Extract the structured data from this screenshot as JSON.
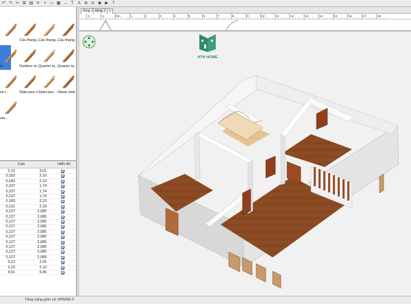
{
  "toolbar": {
    "buttons": [
      "undo-icon",
      "redo-icon",
      "cut-icon",
      "copy-icon",
      "paste-icon",
      "delete-icon",
      "add-furniture-icon",
      "create-walls-icon",
      "create-rooms-icon",
      "create-dimensions-icon",
      "create-labels-icon",
      "text-style-icon",
      "zoom-in-icon",
      "zoom-out-icon",
      "create-photo-icon",
      "create-video-icon",
      "help-icon"
    ]
  },
  "catalog": {
    "items": [
      {
        "label": "",
        "icon": "staircase-icon"
      },
      {
        "label": "Cầu thang...",
        "icon": "staircase-icon"
      },
      {
        "label": "Cầu thang...",
        "icon": "staircase-icon"
      },
      {
        "label": "Cầu thang...",
        "icon": "staircase-icon"
      },
      {
        "label": "d...",
        "icon": "staircase-icon"
      },
      {
        "label": "Outdoor st...",
        "icon": "staircase-icon"
      },
      {
        "label": "Quarter la...",
        "icon": "staircase-icon"
      },
      {
        "label": "Quarter la...",
        "icon": "staircase-icon"
      },
      {
        "label": "se l...",
        "icon": "staircase-icon"
      },
      {
        "label": "Staircase v...",
        "icon": "staircase-icon"
      },
      {
        "label": "Staircase ...",
        "icon": "staircase-icon"
      },
      {
        "label": "Steep stair...",
        "icon": "staircase-icon"
      },
      {
        "label": "sta...",
        "icon": "staircase-icon"
      }
    ]
  },
  "furniture": {
    "headers": {
      "height": "Cao",
      "visible": "Hiển thị"
    },
    "rows": [
      [
        "0,10",
        "3,01"
      ],
      [
        "0,183",
        "2,10"
      ],
      [
        "0,183",
        "2,10"
      ],
      [
        "0,237",
        "1,74"
      ],
      [
        "0,237",
        "1,74"
      ],
      [
        "0,237",
        "1,74"
      ],
      [
        "0,183",
        "2,10"
      ],
      [
        "0,131",
        "2,18"
      ],
      [
        "0,127",
        "2,085"
      ],
      [
        "0,127",
        "2,085"
      ],
      [
        "0,127",
        "2,085"
      ],
      [
        "0,127",
        "2,085"
      ],
      [
        "0,127",
        "2,085"
      ],
      [
        "0,127",
        "2,085"
      ],
      [
        "0,127",
        "2,085"
      ],
      [
        "0,127",
        "2,085"
      ],
      [
        "0,127",
        "2,085"
      ],
      [
        "0,127",
        "2,085"
      ],
      [
        "0,12",
        "2,05"
      ],
      [
        "0,10",
        "2,10"
      ],
      [
        "4,51",
        "5,46"
      ]
    ]
  },
  "status": {
    "total_label": "Tổng cộng gồm cả VAT:",
    "vnd_label": "VND 0"
  },
  "levels": {
    "tabs": [
      "tầng 1",
      "tầng 2"
    ],
    "add": "+"
  },
  "ruler": {
    "labels": [
      "-2",
      "-1",
      "0m",
      "1",
      "2",
      "3",
      "4",
      "5",
      "6",
      "7",
      "8",
      "9",
      "10",
      "11",
      "12",
      "13",
      "14",
      "15",
      "16",
      "17",
      "18"
    ]
  },
  "view3d": {
    "logo_text": "HTH HOME",
    "colors": {
      "wall": "#f4f4f4",
      "wall_shadow": "#d9d9d9",
      "floor": "#8a4a22",
      "accent": "#2f8a6f"
    }
  }
}
